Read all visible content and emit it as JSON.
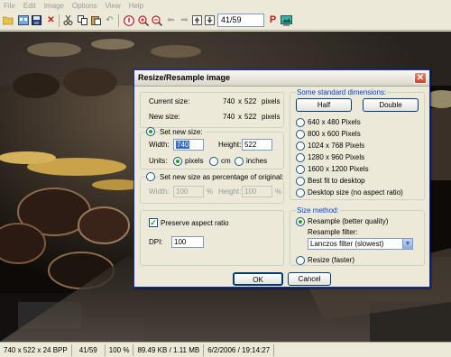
{
  "menu": [
    "File",
    "Edit",
    "Image",
    "Options",
    "View",
    "Help"
  ],
  "toolbar": {
    "icons": [
      "open-folder-icon",
      "thumbnails-icon",
      "save-icon",
      "delete-icon",
      "cut-icon",
      "copy-icon",
      "paste-icon",
      "undo-icon",
      "info-icon",
      "zoom-in-icon",
      "zoom-out-icon",
      "back-arrow-icon",
      "forward-arrow-icon",
      "first-image-icon",
      "last-image-icon",
      "previous-icon",
      "next-icon"
    ],
    "page_value": "41/59"
  },
  "dialog": {
    "title": "Resize/Resample image",
    "close_glyph": "✕",
    "current_size_label": "Current size:",
    "current_w": "740",
    "x1": "x",
    "current_h": "522",
    "current_unit": "pixels",
    "new_size_label": "New size:",
    "new_w": "740",
    "x2": "x",
    "new_h": "522",
    "new_unit": "pixels",
    "set_new_size_legend": "Set new size:",
    "width_label": "Width:",
    "width_value": "740",
    "height_label": "Height:",
    "height_value": "522",
    "units_label": "Units:",
    "unit_options": [
      "pixels",
      "cm",
      "inches"
    ],
    "percent_legend": "Set new size as percentage of original:",
    "pct_width_label": "Width:",
    "pct_width_value": "100",
    "pct_width_unit": "%",
    "pct_height_label": "Height:",
    "pct_height_value": "100",
    "pct_height_unit": "%",
    "preserve_label": "Preserve aspect ratio",
    "dpi_label": "DPI:",
    "dpi_value": "100",
    "standard_legend": "Some standard dimensions:",
    "half_button": "Half",
    "double_button": "Double",
    "dimensions": [
      "640 x 480 Pixels",
      "800 x 600 Pixels",
      "1024 x 768 Pixels",
      "1280 x 960 Pixels",
      "1600 x 1200 Pixels",
      "Best fit to desktop",
      "Desktop size (no aspect ratio)"
    ],
    "size_method_legend": "Size method:",
    "resample_label": "Resample (better quality)",
    "filter_label": "Resample filter:",
    "filter_value": "Lanczos filter (slowest)",
    "resize_label": "Resize (faster)",
    "ok_button": "OK",
    "cancel_button": "Cancel"
  },
  "status": {
    "dimensions": "740 x 522 x 24 BPP",
    "index": "41/59",
    "zoom": "100 %",
    "filesize": "89.49 KB / 1.11 MB",
    "datetime": "6/2/2006 / 19:14:27"
  },
  "colors": {
    "accent": "#0046d5",
    "dialog_bg": "#ece9d8",
    "photo_dark": "#1a1410"
  }
}
